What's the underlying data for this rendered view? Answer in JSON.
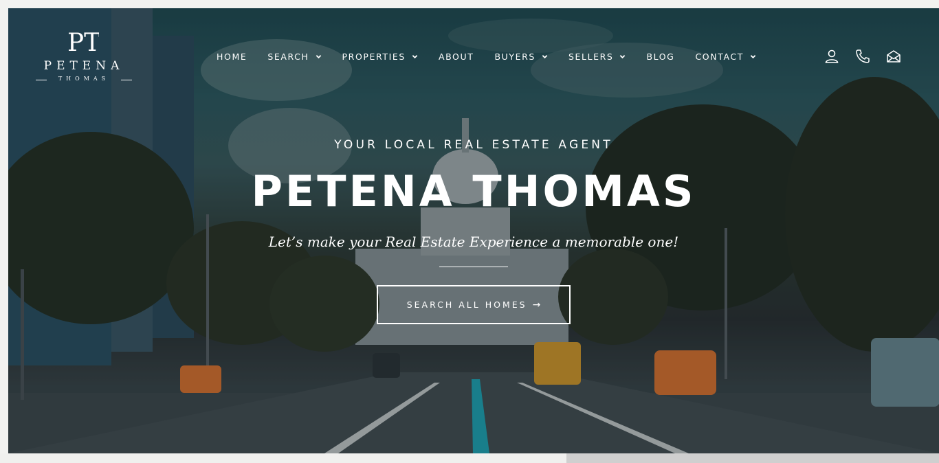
{
  "brand": {
    "monogram": "PT",
    "name": "PETENA",
    "sub": "THOMAS"
  },
  "nav": {
    "items": [
      {
        "label": "HOME",
        "dropdown": false
      },
      {
        "label": "SEARCH",
        "dropdown": true
      },
      {
        "label": "PROPERTIES",
        "dropdown": true
      },
      {
        "label": "ABOUT",
        "dropdown": false
      },
      {
        "label": "BUYERS",
        "dropdown": true
      },
      {
        "label": "SELLERS",
        "dropdown": true
      },
      {
        "label": "BLOG",
        "dropdown": false
      },
      {
        "label": "CONTACT",
        "dropdown": true
      }
    ],
    "icons": [
      "user-icon",
      "phone-icon",
      "mail-icon"
    ]
  },
  "hero": {
    "tagline": "YOUR LOCAL REAL ESTATE AGENT",
    "headline": "PETENA THOMAS",
    "subline": "Let’s make your Real Estate Experience a memorable one!",
    "cta_label": "SEARCH ALL HOMES",
    "cta_arrow": "→"
  },
  "colors": {
    "text": "#ffffff",
    "sky": "#2d5960",
    "road": "#3e474c",
    "taxi": "#e0742f",
    "lane": "#1fa7b8"
  }
}
